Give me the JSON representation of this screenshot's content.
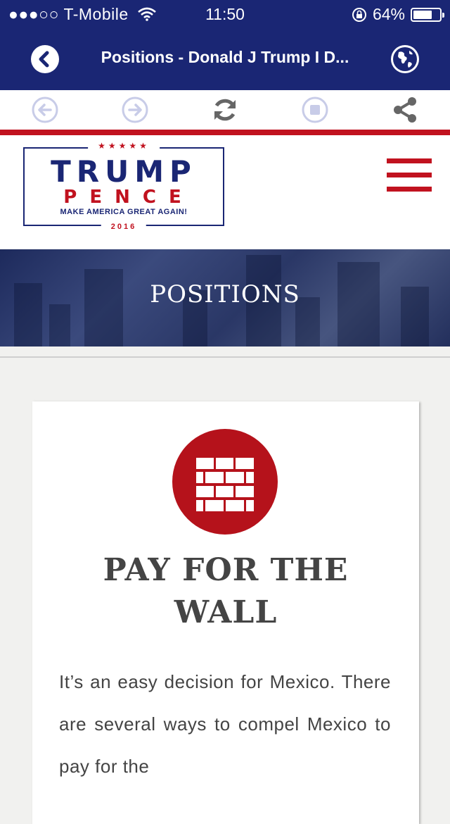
{
  "status_bar": {
    "signal": "●●●○○",
    "carrier": "T-Mobile",
    "time": "11:50",
    "battery_percent": "64%",
    "battery_level": 0.64
  },
  "nav": {
    "title": "Positions - Donald J Trump I D...",
    "back_icon": "chevron-left-icon",
    "globe_icon": "globe-icon"
  },
  "toolbar": {
    "buttons": [
      "back-arrow-icon",
      "forward-arrow-icon",
      "refresh-icon",
      "stop-icon",
      "share-icon"
    ]
  },
  "logo": {
    "stars": "★★★★★",
    "line1": "TRUMP",
    "line2": "PENCE",
    "slogan": "MAKE AMERICA GREAT AGAIN!",
    "year": "2016"
  },
  "banner": {
    "title": "POSITIONS"
  },
  "card": {
    "icon": "brick-wall-icon",
    "title_line1": "PAY FOR THE",
    "title_line2": "WALL",
    "body": "It’s an easy decision for Mexico. There are several ways to compel Mexico to pay for the"
  },
  "colors": {
    "navy": "#1a2674",
    "red": "#c1121f"
  }
}
